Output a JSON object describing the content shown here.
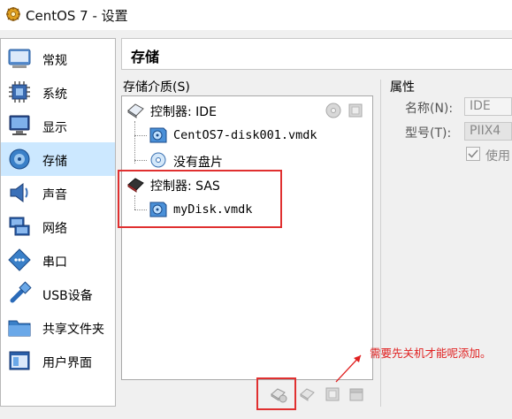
{
  "window": {
    "title": "CentOS 7 - 设置"
  },
  "sidebar": {
    "items": [
      {
        "label": "常规",
        "icon": "general-icon",
        "selected": false
      },
      {
        "label": "系统",
        "icon": "system-icon",
        "selected": false
      },
      {
        "label": "显示",
        "icon": "display-icon",
        "selected": false
      },
      {
        "label": "存储",
        "icon": "storage-icon",
        "selected": true
      },
      {
        "label": "声音",
        "icon": "audio-icon",
        "selected": false
      },
      {
        "label": "网络",
        "icon": "network-icon",
        "selected": false
      },
      {
        "label": "串口",
        "icon": "serial-port-icon",
        "selected": false
      },
      {
        "label": "USB设备",
        "icon": "usb-icon",
        "selected": false
      },
      {
        "label": "共享文件夹",
        "icon": "shared-folder-icon",
        "selected": false
      },
      {
        "label": "用户界面",
        "icon": "user-interface-icon",
        "selected": false
      }
    ]
  },
  "header": {
    "title": "存储"
  },
  "storage": {
    "label": "存储介质(S)",
    "tree": [
      {
        "type": "controller",
        "label": "控制器: IDE",
        "children": [
          "CentOS7-disk001.vmdk",
          "没有盘片"
        ]
      },
      {
        "type": "controller",
        "label": "控制器: SAS",
        "children": [
          "myDisk.vmdk"
        ]
      }
    ]
  },
  "attributes": {
    "title": "属性",
    "name_label": "名称(N):",
    "name_value": "IDE",
    "type_label": "型号(T):",
    "type_value": "PIIX4",
    "use_label": "使用",
    "use_checked": true
  },
  "annotation": "需要先关机才能呢添加。",
  "colors": {
    "selection": "#cce8ff",
    "highlight": "#e03030",
    "annotation_text": "#e02020"
  }
}
